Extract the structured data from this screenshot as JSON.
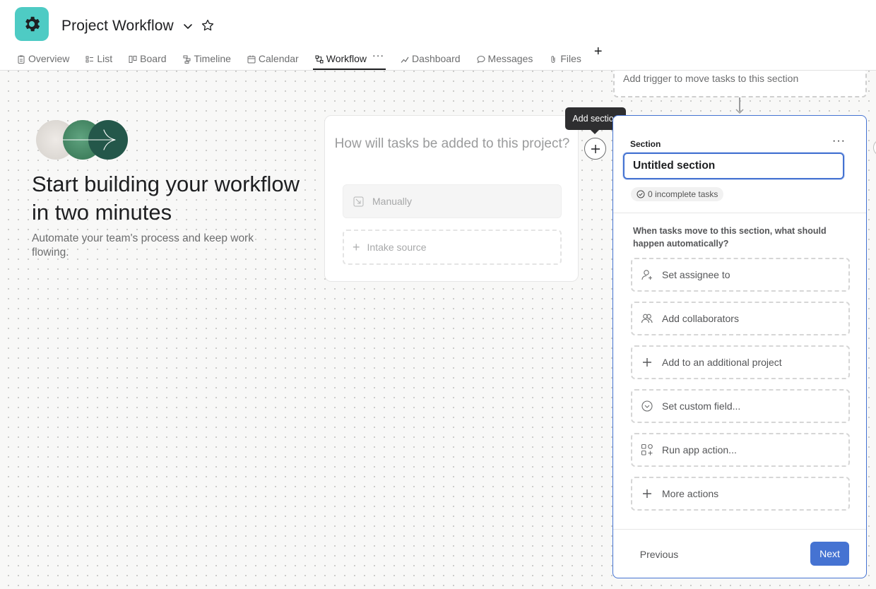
{
  "header": {
    "project_title": "Project Workflow",
    "project_icon": "gear-icon",
    "accent_color": "#4ecbc4"
  },
  "tabs": [
    {
      "label": "Overview",
      "icon": "clipboard-icon"
    },
    {
      "label": "List",
      "icon": "list-icon"
    },
    {
      "label": "Board",
      "icon": "board-icon"
    },
    {
      "label": "Timeline",
      "icon": "timeline-icon"
    },
    {
      "label": "Calendar",
      "icon": "calendar-icon"
    },
    {
      "label": "Workflow",
      "icon": "workflow-icon",
      "active": true
    },
    {
      "label": "Dashboard",
      "icon": "chart-icon"
    },
    {
      "label": "Messages",
      "icon": "message-icon"
    },
    {
      "label": "Files",
      "icon": "paperclip-icon"
    }
  ],
  "hero": {
    "title": "Start building your workflow in two minutes",
    "subtitle": "Automate your team's process and keep work flowing."
  },
  "source_card": {
    "question": "How will tasks be added to this project?",
    "manual_label": "Manually",
    "intake_label": "Intake source"
  },
  "tooltip": {
    "text": "Add section"
  },
  "trigger": {
    "text": "Add trigger to move tasks to this section"
  },
  "section_panel": {
    "label": "Section",
    "name_value": "Untitled section",
    "incomplete_tasks": "0 incomplete tasks",
    "rule_question": "When tasks move to this section, what should happen automatically?",
    "actions": [
      {
        "label": "Set assignee to",
        "icon": "person-add-icon"
      },
      {
        "label": "Add collaborators",
        "icon": "people-icon"
      },
      {
        "label": "Add to an additional project",
        "icon": "plus-icon"
      },
      {
        "label": "Set custom field...",
        "icon": "custom-field-icon"
      },
      {
        "label": "Run app action...",
        "icon": "apps-icon"
      },
      {
        "label": "More actions",
        "icon": "plus-icon"
      }
    ],
    "previous_label": "Previous",
    "next_label": "Next",
    "primary_color": "#4573d2"
  }
}
